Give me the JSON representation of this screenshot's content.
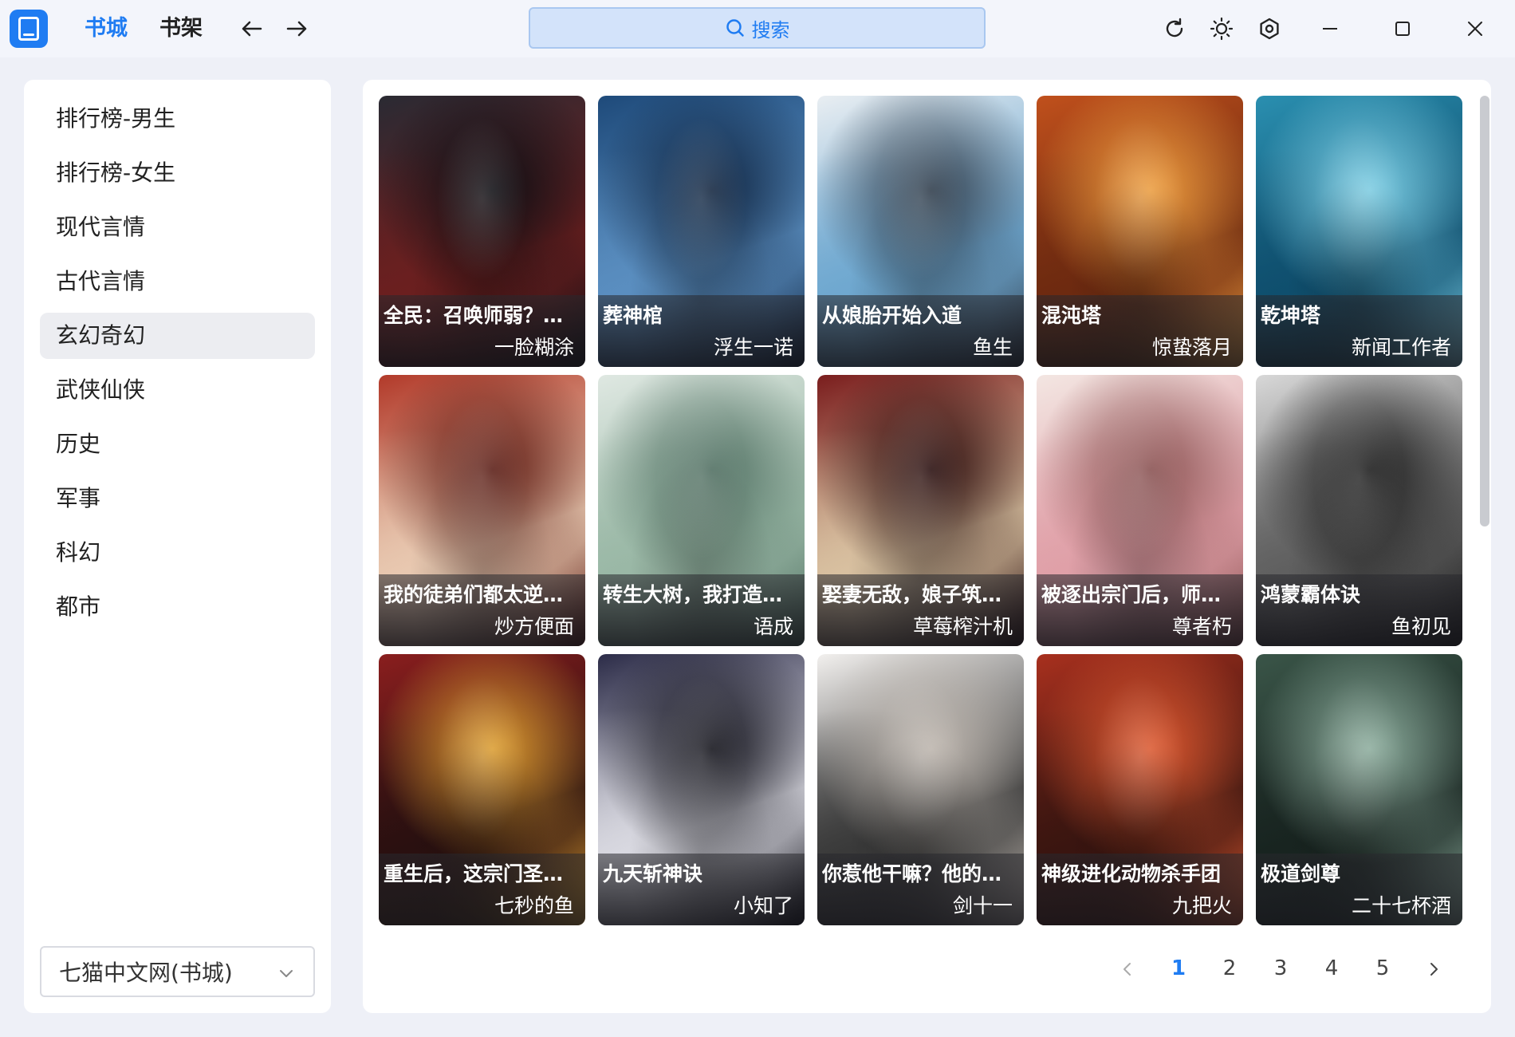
{
  "colors": {
    "accent": "#1f7cf2",
    "background": "#eef0f7",
    "panel": "#ffffff"
  },
  "titlebar": {
    "app_icon": "book-icon",
    "tabs": [
      {
        "label": "书城",
        "active": true
      },
      {
        "label": "书架",
        "active": false
      }
    ],
    "back_icon": "arrow-left-icon",
    "forward_icon": "arrow-right-icon",
    "search": {
      "label": "搜索",
      "icon": "search-icon"
    },
    "tools": [
      "refresh-icon",
      "sun-icon",
      "settings-icon",
      "minimize-icon",
      "maximize-icon",
      "close-icon"
    ]
  },
  "sidebar": {
    "categories": [
      {
        "label": "排行榜-男生",
        "active": false
      },
      {
        "label": "排行榜-女生",
        "active": false
      },
      {
        "label": "现代言情",
        "active": false
      },
      {
        "label": "古代言情",
        "active": false
      },
      {
        "label": "玄幻奇幻",
        "active": true
      },
      {
        "label": "武侠仙侠",
        "active": false
      },
      {
        "label": "历史",
        "active": false
      },
      {
        "label": "军事",
        "active": false
      },
      {
        "label": "科幻",
        "active": false
      },
      {
        "label": "都市",
        "active": false
      }
    ],
    "source_select": {
      "value": "七猫中文网(书城)",
      "icon": "chevron-down-icon"
    }
  },
  "books": [
    {
      "title": "全民：召唤师弱？开局觉醒",
      "author": "一脸糊涂",
      "cover_colors": [
        "#2a2a33",
        "#6b1f1f",
        "#0d0d12"
      ]
    },
    {
      "title": "葬神棺",
      "author": "浮生一诺",
      "cover_colors": [
        "#1e4a7a",
        "#5a8ec0",
        "#10243f"
      ]
    },
    {
      "title": "从娘胎开始入道",
      "author": "鱼生",
      "cover_colors": [
        "#e9eef2",
        "#6fa8d0",
        "#2d3b4a"
      ]
    },
    {
      "title": "混沌塔",
      "author": "惊蛰落月",
      "cover_colors": [
        "#c0501c",
        "#6e2a10",
        "#f0a040"
      ]
    },
    {
      "title": "乾坤塔",
      "author": "新闻工作者",
      "cover_colors": [
        "#2a8fb0",
        "#0f4f6e",
        "#7fd0e6"
      ]
    },
    {
      "title": "我的徒弟们都太逆天了",
      "author": "炒方便面",
      "cover_colors": [
        "#b23a2a",
        "#e8c8b0",
        "#5a1a12"
      ]
    },
    {
      "title": "转生大树，我打造不朽神国",
      "author": "语成",
      "cover_colors": [
        "#dfe8e2",
        "#9ab8a6",
        "#4e6e60"
      ]
    },
    {
      "title": "娶妻无敌，娘子筑基了",
      "author": "草莓榨汁机",
      "cover_colors": [
        "#7a1d1d",
        "#d8c0a0",
        "#260a0a"
      ]
    },
    {
      "title": "被逐出宗门后，师尊悔疯了",
      "author": "尊者朽",
      "cover_colors": [
        "#f3e6e2",
        "#e0a0a8",
        "#8a5050"
      ]
    },
    {
      "title": "鸿蒙霸体诀",
      "author": "鱼初见",
      "cover_colors": [
        "#d8d8d8",
        "#606060",
        "#1a1a1a"
      ]
    },
    {
      "title": "重生后，这宗门圣子我不当了",
      "author": "七秒的鱼",
      "cover_colors": [
        "#8a1e1e",
        "#2a1010",
        "#e0a030"
      ]
    },
    {
      "title": "九天斩神诀",
      "author": "小知了",
      "cover_colors": [
        "#2c2c48",
        "#d8d8e0",
        "#101018"
      ]
    },
    {
      "title": "你惹他干嘛？他的徒弟都成仙帝了",
      "author": "剑十一",
      "cover_colors": [
        "#f2f0ee",
        "#3a3a3a",
        "#c0b8b0"
      ]
    },
    {
      "title": "神级进化动物杀手团",
      "author": "九把火",
      "cover_colors": [
        "#a8301e",
        "#3a1510",
        "#e05a30"
      ]
    },
    {
      "title": "极道剑尊",
      "author": "二十七杯酒",
      "cover_colors": [
        "#3a5548",
        "#182420",
        "#8fb0a0"
      ]
    }
  ],
  "pagination": {
    "prev_icon": "chevron-left-icon",
    "next_icon": "chevron-right-icon",
    "pages": [
      "1",
      "2",
      "3",
      "4",
      "5"
    ],
    "current": "1"
  }
}
